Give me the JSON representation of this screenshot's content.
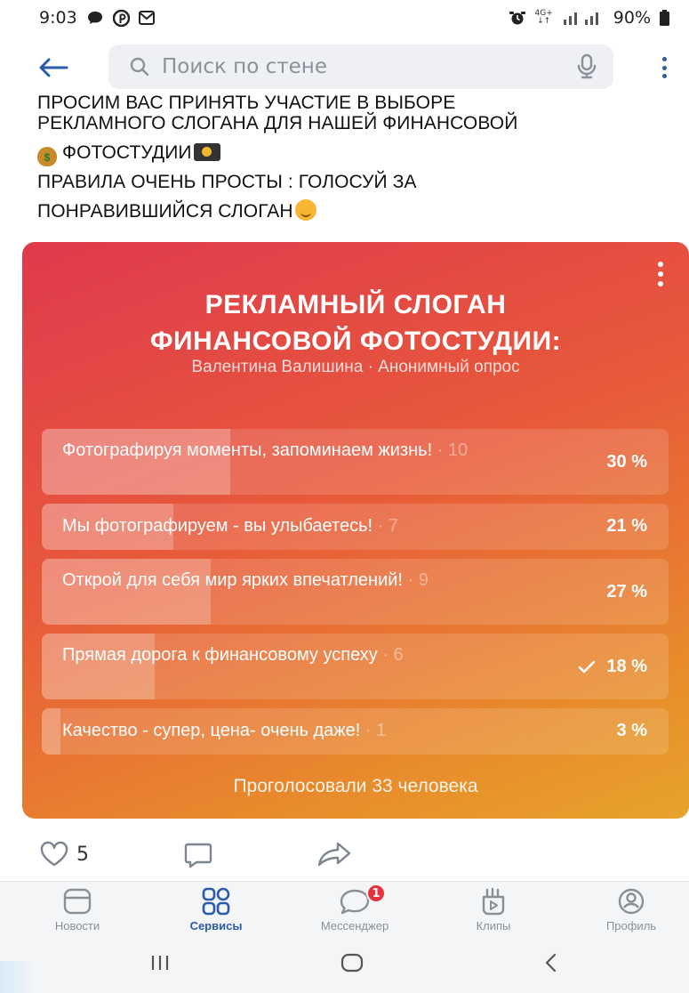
{
  "status_bar": {
    "time": "9:03",
    "network_top": "4G+",
    "network_bottom": "↓↑",
    "battery": "90%"
  },
  "header": {
    "search_placeholder": "Поиск по стене"
  },
  "post": {
    "lines": [
      "ПРОСИМ ВАС ПРИНЯТЬ УЧАСТИЕ В ВЫБОРЕ",
      "РЕКЛАМНОГО СЛОГАНА ДЛЯ НАШЕЙ ФИНАНСОВОЙ",
      "ФОТОСТУДИИ",
      "ПРАВИЛА ОЧЕНЬ ПРОСТЫ : ГОЛОСУЙ ЗА",
      "ПОНРАВИВШИЙСЯ СЛОГАН"
    ]
  },
  "poll": {
    "title_line1": "РЕКЛАМНЫЙ СЛОГАН",
    "title_line2": "ФИНАНСОВОЙ ФОТОСТУДИИ:",
    "meta": "Валентина Валишина · Анонимный опрос",
    "options": [
      {
        "text": "Фотографируя моменты, запоминаем жизнь!",
        "count": " · 10",
        "percent": "30 %",
        "fraction": 0.3,
        "voted": false
      },
      {
        "text": "Мы фотографируем - вы улыбаетесь!",
        "count": " · 7",
        "percent": "21 %",
        "fraction": 0.21,
        "voted": false
      },
      {
        "text": "Открой для себя мир ярких впечатлений!",
        "count": " · 9",
        "percent": "27 %",
        "fraction": 0.27,
        "voted": false
      },
      {
        "text": "Прямая дорога к финансовому успеху",
        "count": " · 6",
        "percent": "18 %",
        "fraction": 0.18,
        "voted": true
      },
      {
        "text": "Качество - супер, цена- очень даже!",
        "count": " · 1",
        "percent": "3 %",
        "fraction": 0.03,
        "voted": false
      }
    ],
    "footer": "Проголосовали 33 человека"
  },
  "actions": {
    "likes": "5"
  },
  "bottom_nav": {
    "items": [
      {
        "label": "Новости",
        "icon": "news-icon"
      },
      {
        "label": "Сервисы",
        "icon": "services-icon"
      },
      {
        "label": "Мессенджер",
        "icon": "messenger-icon"
      },
      {
        "label": "Клипы",
        "icon": "clips-icon"
      },
      {
        "label": "Профиль",
        "icon": "profile-icon"
      }
    ],
    "active_index": 1,
    "messenger_badge": "1"
  },
  "colors": {
    "accent": "#2a5ca8",
    "poll_gradient_start": "#df3a4d",
    "poll_gradient_end": "#e6a42a",
    "badge": "#e6323e"
  }
}
